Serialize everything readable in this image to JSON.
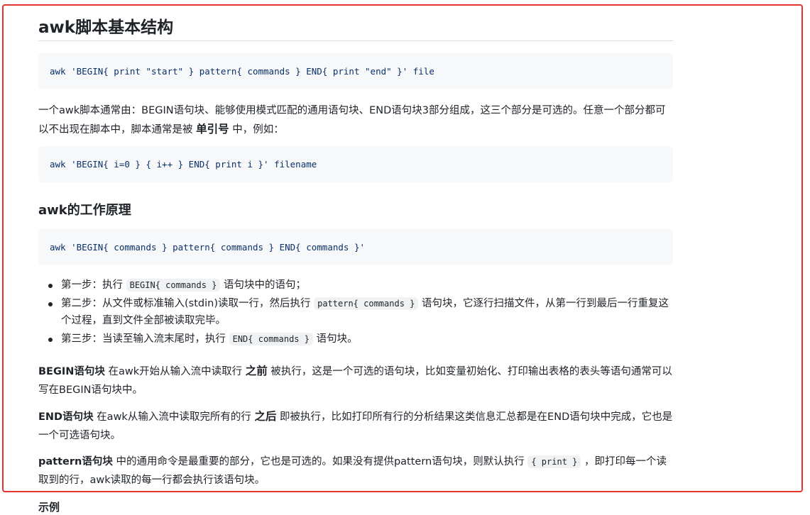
{
  "title": "awk脚本基本结构",
  "code1": {
    "text": "awk 'BEGIN{ print \"start\" } pattern{ commands } END{ print \"end\" }' file"
  },
  "para1": {
    "text1": "一个awk脚本通常由：BEGIN语句块、能够使用模式匹配的通用语句块、END语句块3部分组成，这三个部分是可选的。任意一个部分都可以不出现在脚本中，脚本通常是被 ",
    "strong": "单引号",
    "text2": " 中，例如："
  },
  "code2": {
    "text": "awk 'BEGIN{ i=0 } { i++ } END{ print i }' filename"
  },
  "section_title": "awk的工作原理",
  "code3": {
    "text": "awk 'BEGIN{ commands } pattern{ commands } END{ commands }'"
  },
  "steps": [
    {
      "pre": "第一步：执行 ",
      "code": "BEGIN{ commands }",
      "post": " 语句块中的语句；"
    },
    {
      "pre": "第二步：从文件或标准输入(stdin)读取一行，然后执行 ",
      "code": "pattern{ commands }",
      "post": " 语句块，它逐行扫描文件，从第一行到最后一行重复这个过程，直到文件全部被读取完毕。"
    },
    {
      "pre": "第三步：当读至输入流末尾时，执行 ",
      "code": "END{ commands }",
      "post": " 语句块。"
    }
  ],
  "begin_para": {
    "label": "BEGIN语句块",
    "text1": " 在awk开始从输入流中读取行 ",
    "strong": "之前",
    "text2": " 被执行，这是一个可选的语句块，比如变量初始化、打印输出表格的表头等语句通常可以写在BEGIN语句块中。"
  },
  "end_para": {
    "label": "END语句块",
    "text1": " 在awk从输入流中读取完所有的行 ",
    "strong": "之后",
    "text2": " 即被执行，比如打印所有行的分析结果这类信息汇总都是在END语句块中完成，它也是一个可选语句块。"
  },
  "pattern_para": {
    "label": "pattern语句块",
    "text1": " 中的通用命令是最重要的部分，它也是可选的。如果没有提供pattern语句块，则默认执行 ",
    "code": "{ print }",
    "text2": " ，即打印每一个读取到的行，awk读取的每一行都会执行该语句块。"
  },
  "example_heading": "示例",
  "colors": {
    "highlight_frame": "#e5332f",
    "code_bg": "#f6f8fa",
    "code_string": "#0a3069"
  }
}
